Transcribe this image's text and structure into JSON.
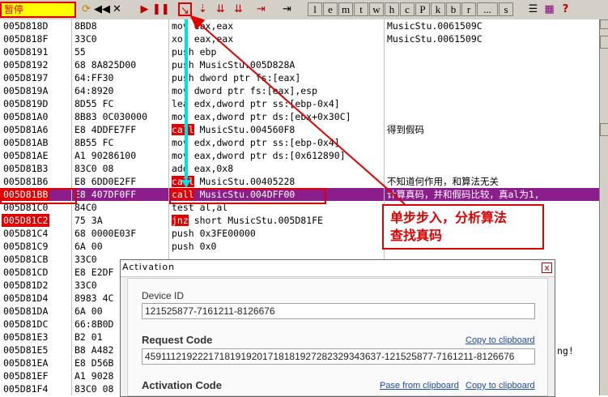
{
  "toolbar": {
    "status": "暂停",
    "buttons": [
      "l",
      "e",
      "m",
      "t",
      "w",
      "h",
      "c",
      "P",
      "k",
      "b",
      "r",
      "...",
      "s"
    ]
  },
  "rows": [
    {
      "addr": "005D818D",
      "hex": "8BD8",
      "instr": "mov ebx,eax",
      "cmt": "MusicStu.0061509C"
    },
    {
      "addr": "005D818F",
      "hex": "33C0",
      "instr": "xor eax,eax",
      "cmt": "MusicStu.0061509C"
    },
    {
      "addr": "005D8191",
      "hex": "55",
      "instr": "push ebp",
      "cmt": ""
    },
    {
      "addr": "005D8192",
      "hex": "68 8A825D00",
      "instr": "push MusicStu.005D828A",
      "cmt": ""
    },
    {
      "addr": "005D8197",
      "hex": "64:FF30",
      "instr": "push dword ptr fs:[eax]",
      "cmt": ""
    },
    {
      "addr": "005D819A",
      "hex": "64:8920",
      "instr": "mov dword ptr fs:[eax],esp",
      "cmt": ""
    },
    {
      "addr": "005D819D",
      "hex": "8D55 FC",
      "instr": "lea edx,dword ptr ss:[ebp-0x4]",
      "cmt": ""
    },
    {
      "addr": "005D81A0",
      "hex": "8B83 0C030000",
      "instr": "mov eax,dword ptr ds:[ebx+0x30C]",
      "cmt": ""
    },
    {
      "addr": "005D81A6",
      "hex": "E8 4DDFE7FF",
      "instr": "call MusicStu.004560F8",
      "cmt": "得到假码"
    },
    {
      "addr": "005D81AB",
      "hex": "8B55 FC",
      "instr": "mov edx,dword ptr ss:[ebp-0x4]",
      "cmt": ""
    },
    {
      "addr": "005D81AE",
      "hex": "A1 90286100",
      "instr": "mov eax,dword ptr ds:[0x612890]",
      "cmt": ""
    },
    {
      "addr": "005D81B3",
      "hex": "83C0 08",
      "instr": "add eax,0x8",
      "cmt": ""
    },
    {
      "addr": "005D81B6",
      "hex": "E8 6DD0E2FF",
      "instr": "call MusicStu.00405228",
      "cmt": "不知道何作用，和算法无关"
    },
    {
      "addr": "005D81BB",
      "hex": "E8 407DF0FF",
      "instr": "call MusicStu.004DFF00",
      "cmt": "计算真码，并和假码比较，真al为1,"
    },
    {
      "addr": "005D81C0",
      "hex": "84C0",
      "instr": "test al,al",
      "cmt": ""
    },
    {
      "addr": "005D81C2",
      "hex": "75 3A",
      "instr": "jnz short MusicStu.005D81FE",
      "cmt": ""
    },
    {
      "addr": "005D81C4",
      "hex": "68 0000E03F",
      "instr": "push 0x3FE00000",
      "cmt": ""
    },
    {
      "addr": "005D81C9",
      "hex": "6A 00",
      "instr": "push 0x0",
      "cmt": ""
    },
    {
      "addr": "005D81CB",
      "hex": "33C0",
      "instr": "",
      "cmt": ""
    },
    {
      "addr": "005D81CD",
      "hex": "E8 E2DF",
      "instr": "",
      "cmt": ""
    },
    {
      "addr": "005D81D2",
      "hex": "33C0",
      "instr": "",
      "cmt": ""
    },
    {
      "addr": "005D81D4",
      "hex": "8983 4C",
      "instr": "",
      "cmt": ""
    },
    {
      "addr": "005D81DA",
      "hex": "6A 00",
      "instr": "",
      "cmt": ""
    },
    {
      "addr": "005D81DC",
      "hex": "66:8B0D",
      "instr": "",
      "cmt": ""
    },
    {
      "addr": "005D81E3",
      "hex": "B2 01",
      "instr": "",
      "cmt": ""
    },
    {
      "addr": "005D81E5",
      "hex": "B8 A482",
      "instr": "",
      "cmt": ""
    },
    {
      "addr": "005D81EA",
      "hex": "E8 D56B",
      "instr": "",
      "cmt": ""
    },
    {
      "addr": "005D81EF",
      "hex": "A1 9028",
      "instr": "",
      "cmt": ""
    },
    {
      "addr": "005D81F4",
      "hex": "83C0 08",
      "instr": "",
      "cmt": ""
    }
  ],
  "behind_text": "ng!",
  "annotation": {
    "line1": "单步步入，分析算法",
    "line2": "查找真码"
  },
  "dialog": {
    "title": "Activation",
    "close_glyph": "x",
    "device_id_label": "Device ID",
    "device_id_value": "121525877-7161211-8126676",
    "request_code_label": "Request Code",
    "request_code_value": "45911121922217181919201718181927282329343637-121525877-7161211-8126676",
    "copy_link": "Copy to clipboard",
    "activation_code_label": "Activation Code",
    "paste_link": "Pase from clipboard",
    "copy_link2": "Copy to clipboard"
  },
  "colors": {
    "accent_red": "#e00000",
    "selection": "#8c1e8c",
    "cyan": "#00e0e0"
  }
}
